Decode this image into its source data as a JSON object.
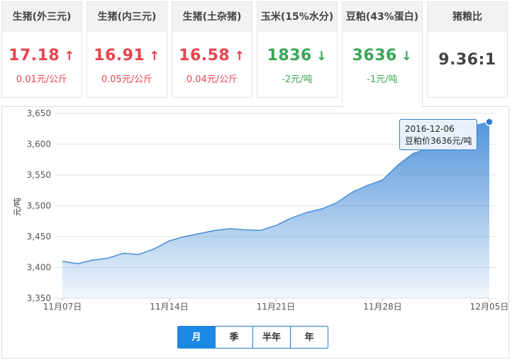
{
  "cards": [
    {
      "title": "生猪(外三元)",
      "value": "17.18",
      "change": "0.01元/公斤",
      "trend": "up"
    },
    {
      "title": "生猪(内三元)",
      "value": "16.91",
      "change": "0.05元/公斤",
      "trend": "up"
    },
    {
      "title": "生猪(土杂猪)",
      "value": "16.58",
      "change": "0.04元/公斤",
      "trend": "up"
    },
    {
      "title": "玉米(15%水分)",
      "value": "1836",
      "change": "-2元/吨",
      "trend": "down"
    },
    {
      "title": "豆粕(43%蛋白)",
      "value": "3636",
      "change": "-1元/吨",
      "trend": "down",
      "active": true
    },
    {
      "title": "猪粮比",
      "value": "9.36:1",
      "change": "",
      "trend": "neutral"
    }
  ],
  "icons": {
    "up": "↑",
    "down": "↓"
  },
  "colors": {
    "up": "#e8444f",
    "down": "#3aa655",
    "line": "#4a8fd8",
    "active_button": "#1e88e5"
  },
  "tooltip": {
    "date": "2016-12-06",
    "text": "豆粕价3636元/吨"
  },
  "buttons": [
    {
      "label": "月",
      "selected": true
    },
    {
      "label": "季",
      "selected": false
    },
    {
      "label": "半年",
      "selected": false
    },
    {
      "label": "年",
      "selected": false
    }
  ],
  "chart_data": {
    "type": "area",
    "ylabel": "元/吨",
    "ylim": [
      3350,
      3650
    ],
    "yticks": [
      3350,
      3400,
      3450,
      3500,
      3550,
      3600,
      3650
    ],
    "ytick_labels": [
      "3,350",
      "3,400",
      "3,450",
      "3,500",
      "3,550",
      "3,600",
      "3,650"
    ],
    "xtick_labels": [
      "11月07日",
      "11月14日",
      "11月21日",
      "11月28日",
      "12月05日"
    ],
    "grid": true,
    "series": [
      {
        "values": [
          3410,
          3406,
          3412,
          3415,
          3423,
          3421,
          3430,
          3443,
          3450,
          3455,
          3460,
          3463,
          3461,
          3460,
          3468,
          3480,
          3489,
          3495,
          3505,
          3522,
          3533,
          3542,
          3566,
          3585,
          3593,
          3604,
          3617,
          3630,
          3636
        ]
      }
    ]
  }
}
